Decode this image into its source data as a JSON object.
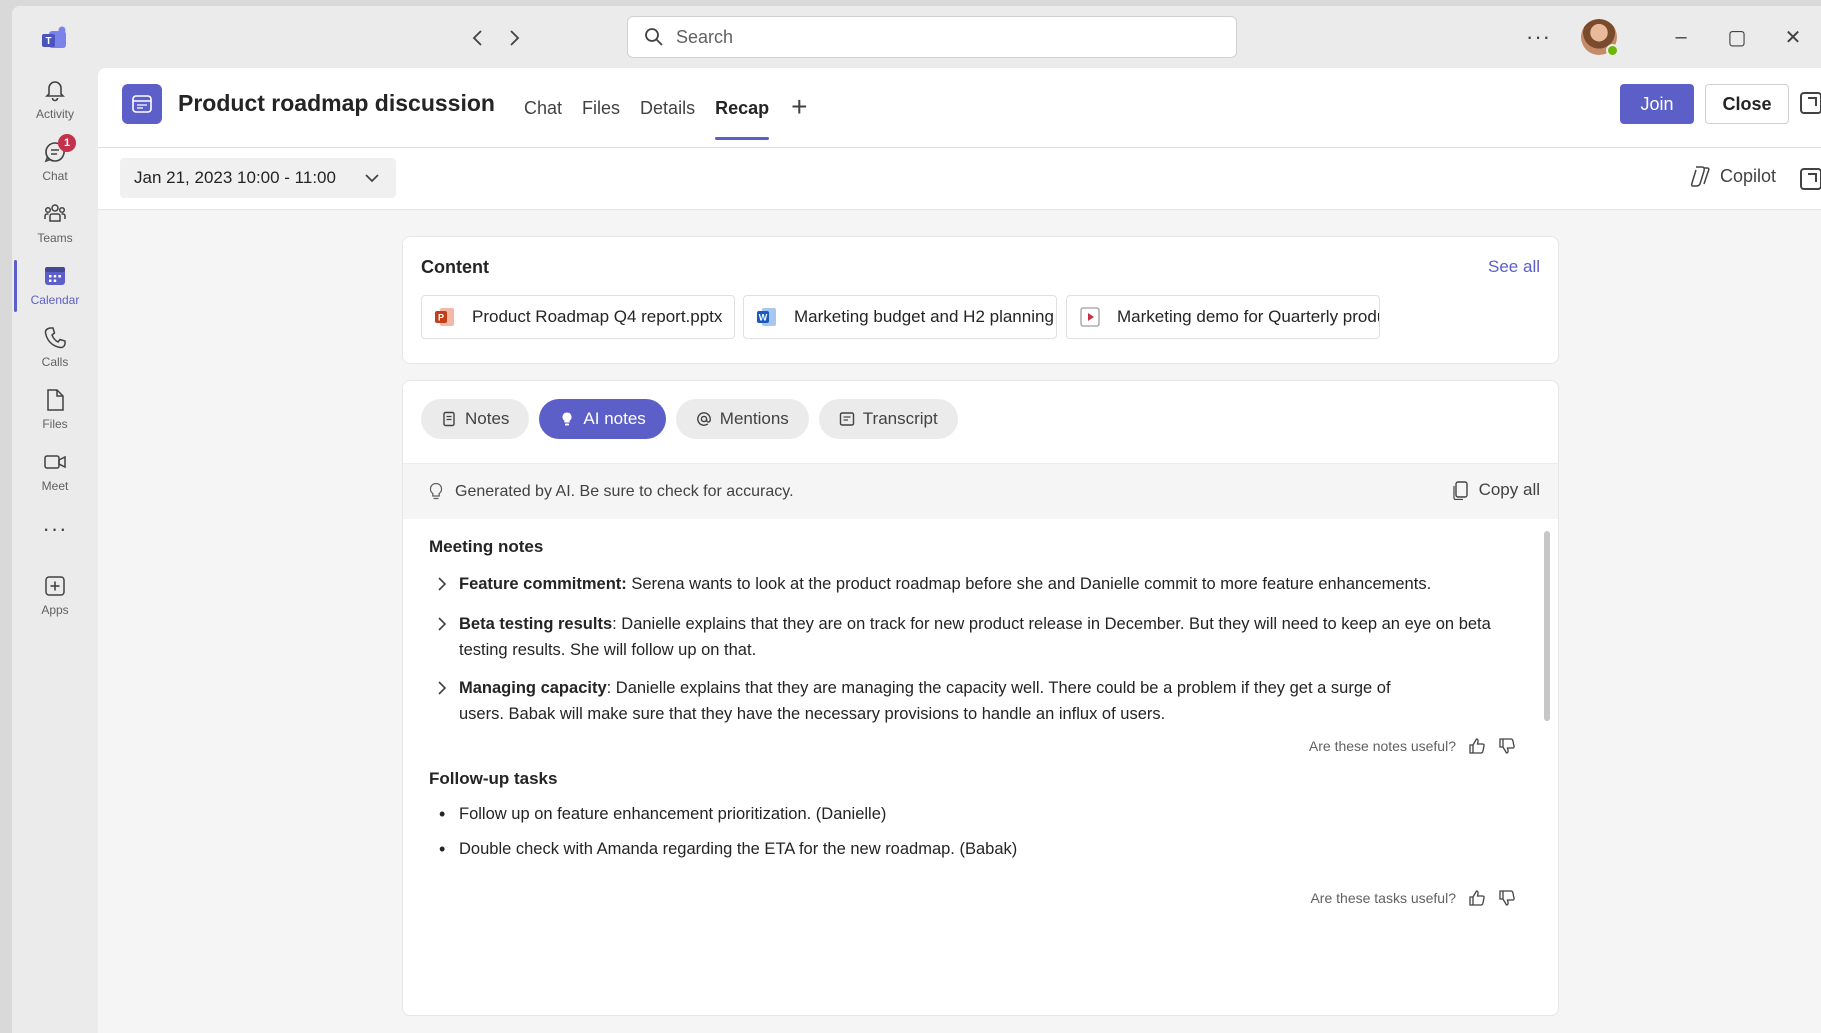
{
  "titlebar": {
    "search_placeholder": "Search",
    "back_icon": "chevron-left-icon",
    "forward_icon": "chevron-right-icon",
    "more_label": "···",
    "minimize_label": "–",
    "maximize_label": "▢",
    "close_label": "✕"
  },
  "rail": {
    "items": [
      {
        "label": "Activity",
        "icon": "bell-icon"
      },
      {
        "label": "Chat",
        "icon": "chat-icon",
        "badge": "1"
      },
      {
        "label": "Teams",
        "icon": "teams-icon"
      },
      {
        "label": "Calendar",
        "icon": "calendar-icon",
        "active": true
      },
      {
        "label": "Calls",
        "icon": "phone-icon"
      },
      {
        "label": "Files",
        "icon": "file-icon"
      },
      {
        "label": "Meet",
        "icon": "video-icon"
      },
      {
        "label": "Apps",
        "icon": "add-app-icon"
      }
    ],
    "more_label": "···"
  },
  "header": {
    "title": "Product roadmap discussion",
    "tabs": [
      "Chat",
      "Files",
      "Details",
      "Recap"
    ],
    "active_tab": "Recap",
    "add_tab": "+",
    "join_label": "Join",
    "close_label": "Close"
  },
  "subheader": {
    "date_range": "Jan 21, 2023 10:00 - 11:00",
    "copilot_label": "Copilot"
  },
  "content": {
    "title": "Content",
    "see_all": "See all",
    "files": [
      {
        "name": "Product Roadmap Q4 report.pptx",
        "type": "powerpoint"
      },
      {
        "name": "Marketing budget and H2 planning",
        "type": "word"
      },
      {
        "name": "Marketing demo for Quarterly produ...",
        "type": "video"
      }
    ]
  },
  "notes": {
    "pills": [
      "Notes",
      "AI notes",
      "Mentions",
      "Transcript"
    ],
    "active_pill": "AI notes",
    "ai_banner": "Generated by AI. Be sure to check for accuracy.",
    "copy_all": "Copy all",
    "meeting_notes_title": "Meeting notes",
    "meeting_notes": [
      {
        "heading": "Feature commitment:",
        "text": " Serena wants to look at the product roadmap before she and Danielle commit to more feature enhancements."
      },
      {
        "heading": "Beta testing results",
        "text": ": Danielle explains that they are on track for new product release in December. But they will need to keep an eye on beta testing results. She will follow up on that."
      },
      {
        "heading": "Managing capacity",
        "text": ": Danielle explains that they are managing the capacity well. There could be a problem if they get a surge of users. Babak will make sure that they have the necessary provisions to handle an influx of users."
      }
    ],
    "notes_feedback": "Are these notes useful?",
    "tasks_title": "Follow-up tasks",
    "tasks": [
      "Follow up on feature enhancement prioritization. (Danielle)",
      "Double check with Amanda regarding the ETA for the new roadmap. (Babak)"
    ],
    "tasks_feedback": "Are these tasks useful?"
  },
  "colors": {
    "accent": "#5b5fc7",
    "badge": "#c4314b",
    "presence": "#6bb700"
  }
}
